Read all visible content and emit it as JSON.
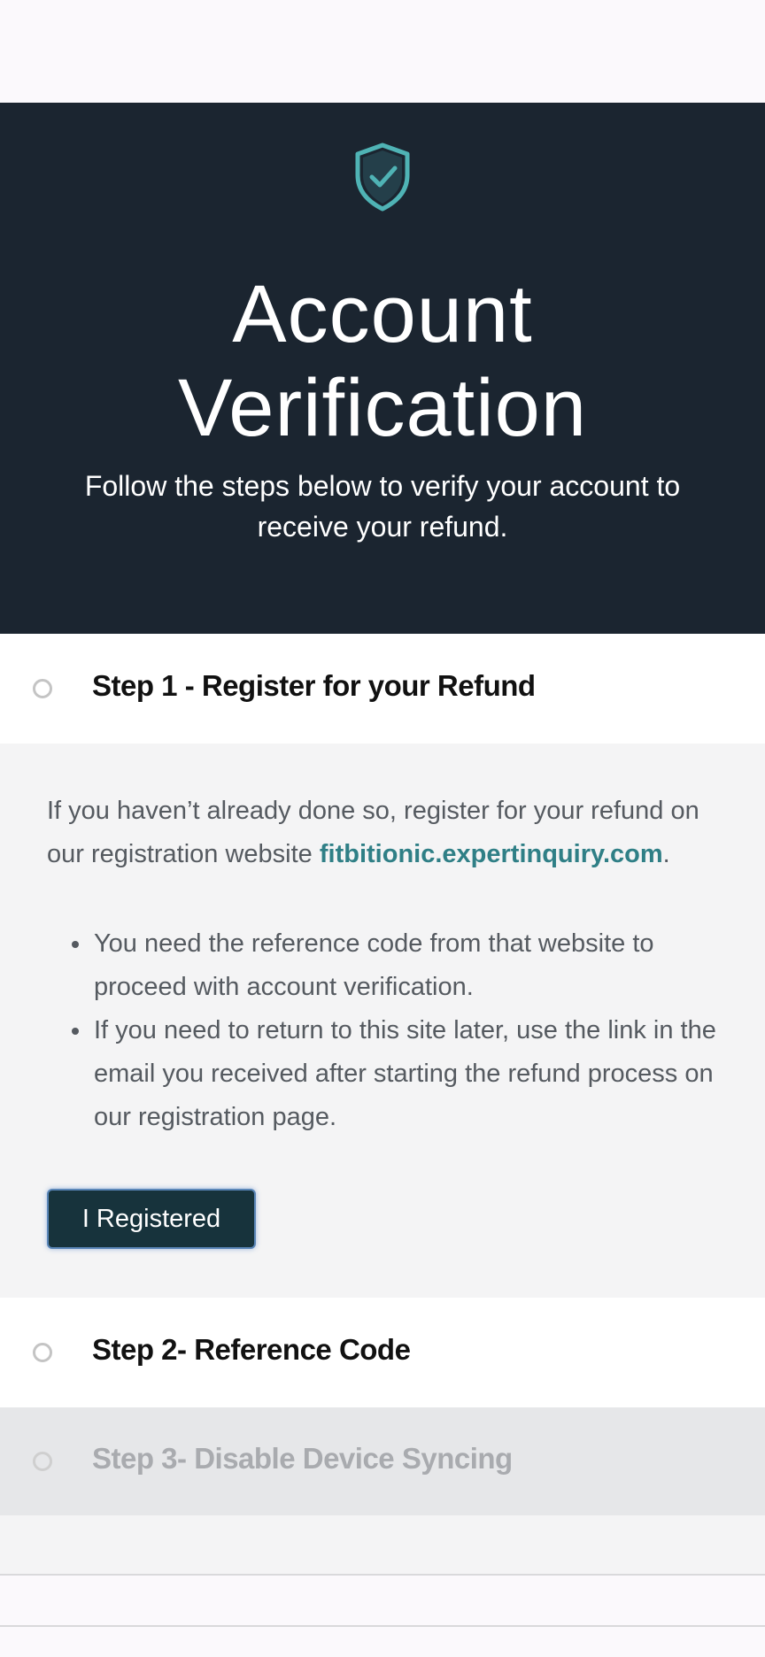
{
  "hero": {
    "title_line1": "Account",
    "title_line2": "Verification",
    "subtitle": "Follow the steps below to verify your account to receive your refund.",
    "icon": "shield-check-icon",
    "background": "#1b2530",
    "accent": "#4fb3b5"
  },
  "steps": [
    {
      "title": "Step 1 - Register for your Refund",
      "body_prefix": "If you haven’t already done so, register for your refund on our registration website ",
      "link_text": "fitbitionic.expertinquiry.com",
      "body_suffix": ".",
      "bullets": [
        "You need the reference code from that website to proceed with account verification.",
        "If you need to return to this site later, use the link in the email you received after starting the refund process on our registration page."
      ],
      "button_label": "I Registered"
    },
    {
      "title": "Step 2- Reference Code"
    },
    {
      "title": "Step 3- Disable Device Syncing"
    }
  ],
  "colors": {
    "link": "#2f7f86",
    "button_bg": "#17333c",
    "disabled_text": "#a9abaf"
  }
}
